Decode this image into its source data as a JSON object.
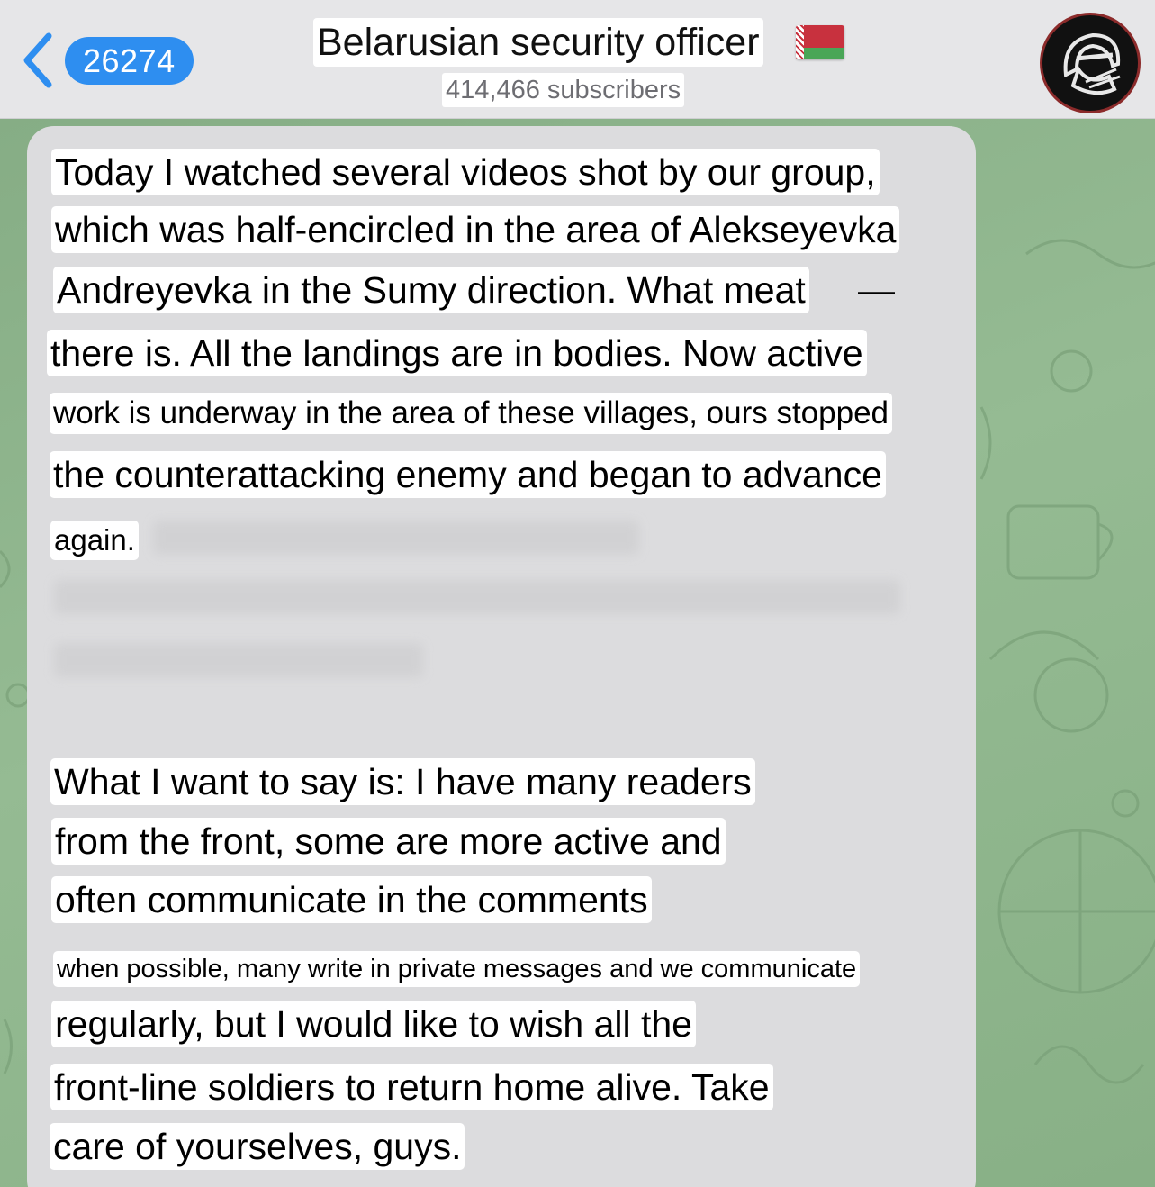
{
  "header": {
    "back_count": "26274",
    "channel_title": "Belarusian security officer",
    "flag_icon": "belarus-flag-icon",
    "subscribers": "414,466 subscribers",
    "avatar_icon": "masked-soldier-avatar-icon"
  },
  "message": {
    "paragraph1": [
      "Today I watched several videos shot by our group,",
      "which was half-encircled in the area of Alekseyevka",
      "Andreyevka in the Sumy direction. What meat",
      "there is. All the landings are in bodies. Now active",
      "work is underway in the area of these villages, ours stopped",
      "the counterattacking enemy and began to advance",
      "again."
    ],
    "dash": "—",
    "paragraph2": [
      "What I want to say is: I have many readers",
      "from the front, some are more active and",
      "often communicate in the comments",
      "when possible, many write in private messages and we communicate",
      "regularly, but I would like to wish all the",
      "front-line soldiers to return home alive. Take",
      "care of yourselves, guys."
    ]
  },
  "colors": {
    "header_bg": "#e6e6e8",
    "badge_blue": "#2e8ef0",
    "bubble_bg": "#dcdcde",
    "wallpaper_green": "#8fb58e"
  }
}
